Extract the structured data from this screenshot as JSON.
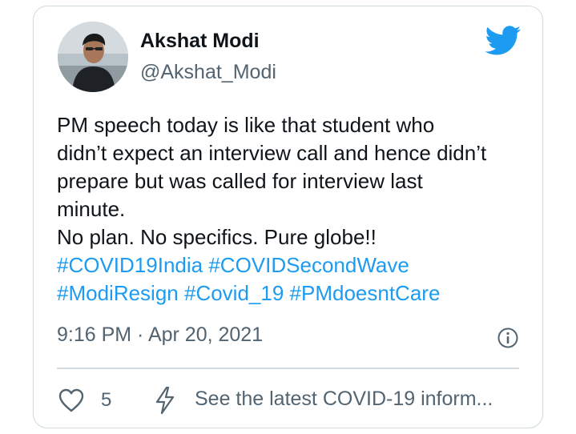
{
  "tweet": {
    "author": {
      "display_name": "Akshat Modi",
      "handle": "@Akshat_Modi",
      "avatar_icon": "user-photo-avatar"
    },
    "brand_icon": "twitter-bird-icon",
    "brand_color": "#1d9bf0",
    "text_lines": [
      "PM speech today is like that student who",
      "didn’t expect an interview call and hence didn’t",
      "prepare but was called for interview last",
      "minute.",
      "No plan. No specifics. Pure globe!!"
    ],
    "hashtags_line1": [
      "#COVID19India",
      "#COVIDSecondWave"
    ],
    "hashtags_line2": [
      "#ModiResign",
      "#Covid_19",
      "#PMdoesntCare"
    ],
    "hashtag_color": "#1d9bf0",
    "timestamp": "9:16 PM · Apr 20, 2021",
    "info_icon": "info-icon"
  },
  "actions": {
    "like_icon": "heart-icon",
    "like_count": "5",
    "covid_icon": "lightning-bolt-icon",
    "covid_info_label": "See the latest COVID-19 inform..."
  }
}
